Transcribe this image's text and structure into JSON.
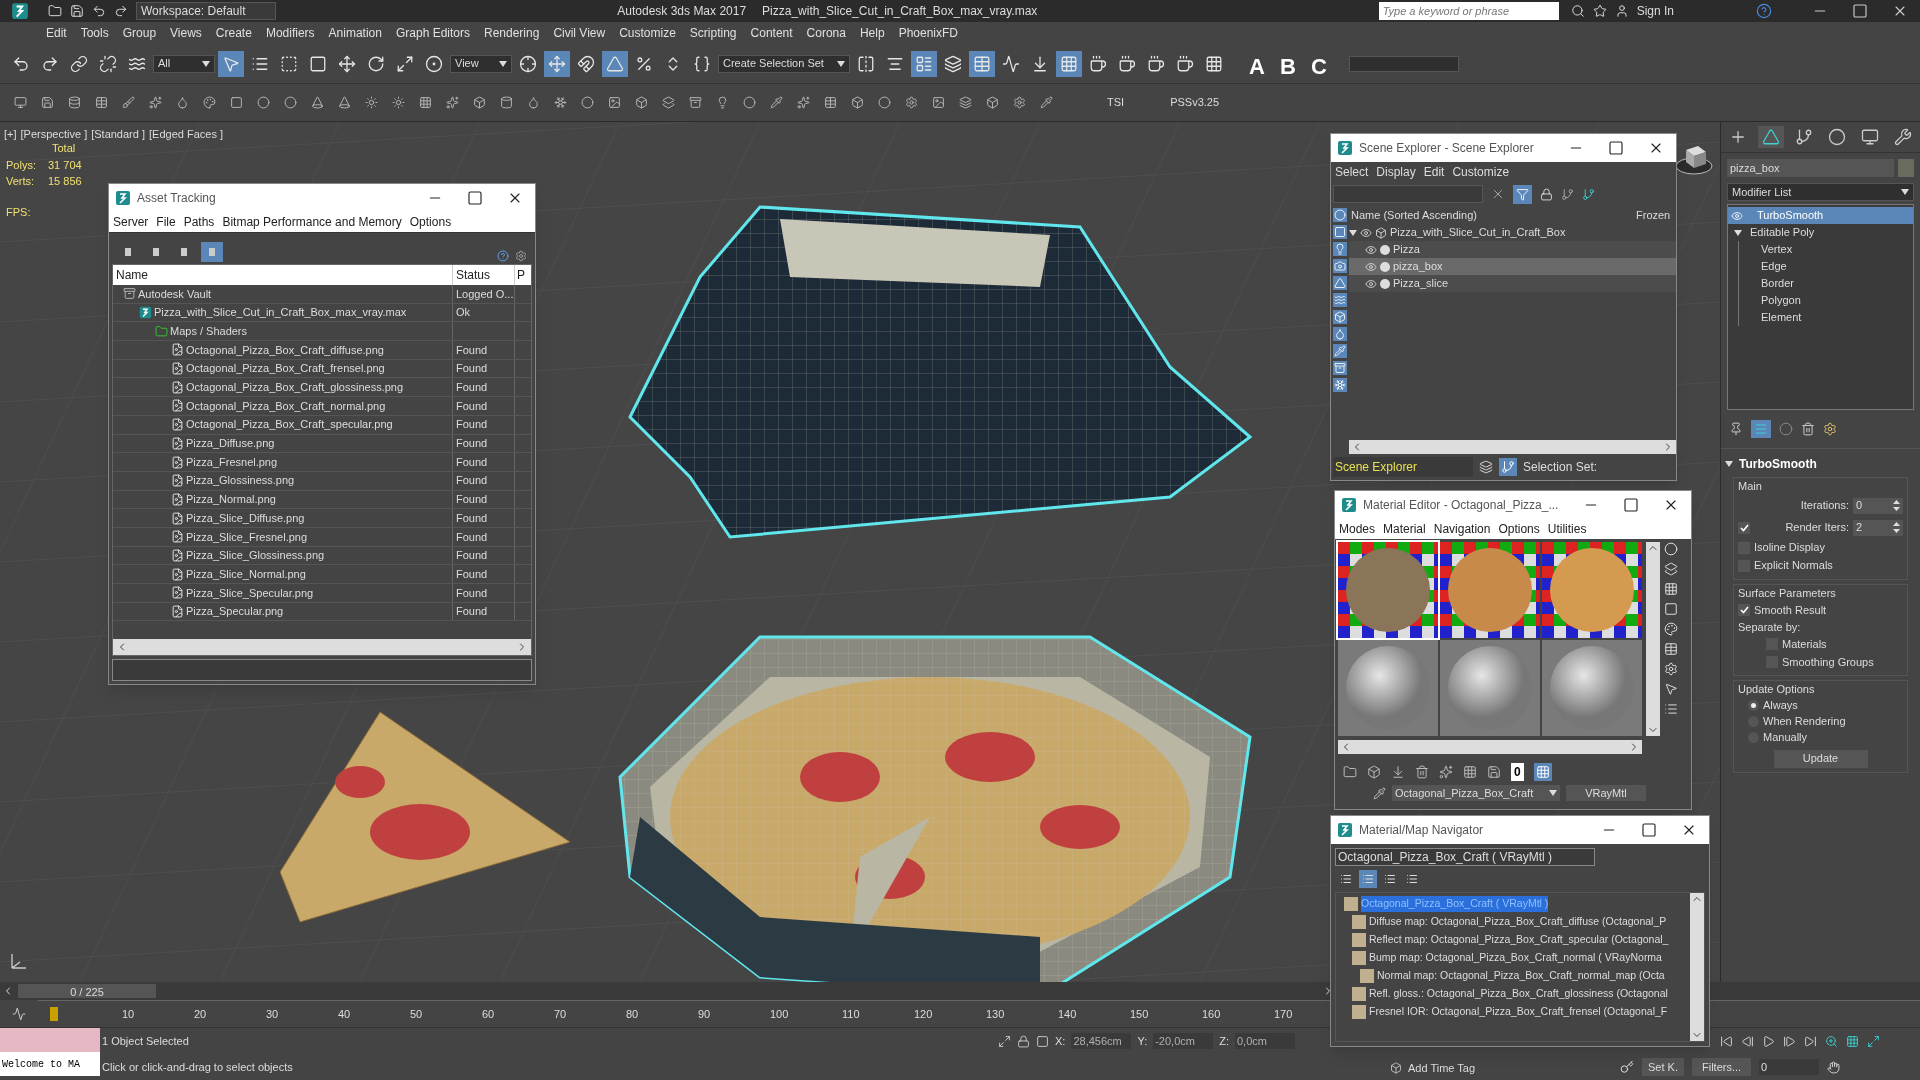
{
  "title_bar": {
    "workspace": "Workspace: Default",
    "app_title": "Autodesk 3ds Max 2017",
    "file_title": "Pizza_with_Slice_Cut_in_Craft_Box_max_vray.max",
    "search_placeholder": "Type a keyword or phrase",
    "sign_in": "Sign In"
  },
  "menu": [
    "Edit",
    "Tools",
    "Group",
    "Views",
    "Create",
    "Modifiers",
    "Animation",
    "Graph Editors",
    "Rendering",
    "Civil View",
    "Customize",
    "Scripting",
    "Content",
    "Corona",
    "Help",
    "PhoenixFD"
  ],
  "main_toolbar": {
    "selection_filter": "All",
    "reference_coordinate": "View",
    "selection_set": "Create Selection Set",
    "letter_tools": [
      "A",
      "B",
      "C"
    ]
  },
  "secondary_toolbar": {
    "labels": [
      "TSI",
      "PSSv3.25"
    ]
  },
  "viewport": {
    "labels": [
      "[+]",
      "[Perspective ]",
      "[Standard ]",
      "[Edged Faces ]"
    ],
    "stats_header": "Total",
    "stats": [
      {
        "label": "Polys:",
        "value": "31 704"
      },
      {
        "label": "Verts:",
        "value": "15 856"
      }
    ],
    "fps": "FPS:"
  },
  "asset_tracking": {
    "title": "Asset Tracking",
    "menu": [
      "Server",
      "File",
      "Paths",
      "Bitmap Performance and Memory",
      "Options"
    ],
    "view_buttons": [
      {
        "selected": false
      },
      {
        "selected": false
      },
      {
        "selected": false
      },
      {
        "selected": true
      }
    ],
    "columns": [
      "Name",
      "Status",
      "P"
    ],
    "tree": [
      {
        "kind": "vault",
        "name": "Autodesk Vault",
        "status": "Logged O...",
        "children": [
          {
            "kind": "max",
            "name": "Pizza_with_Slice_Cut_in_Craft_Box_max_vray.max",
            "status": "Ok",
            "children": [
              {
                "kind": "folder",
                "name": "Maps / Shaders",
                "children": [
                  {
                    "kind": "bitmap",
                    "name": "Octagonal_Pizza_Box_Craft_diffuse.png",
                    "status": "Found"
                  },
                  {
                    "kind": "bitmap",
                    "name": "Octagonal_Pizza_Box_Craft_frensel.png",
                    "status": "Found"
                  },
                  {
                    "kind": "bitmap",
                    "name": "Octagonal_Pizza_Box_Craft_glossiness.png",
                    "status": "Found"
                  },
                  {
                    "kind": "bitmap",
                    "name": "Octagonal_Pizza_Box_Craft_normal.png",
                    "status": "Found"
                  },
                  {
                    "kind": "bitmap",
                    "name": "Octagonal_Pizza_Box_Craft_specular.png",
                    "status": "Found"
                  },
                  {
                    "kind": "bitmap",
                    "name": "Pizza_Diffuse.png",
                    "status": "Found"
                  },
                  {
                    "kind": "bitmap",
                    "name": "Pizza_Fresnel.png",
                    "status": "Found"
                  },
                  {
                    "kind": "bitmap",
                    "name": "Pizza_Glossiness.png",
                    "status": "Found"
                  },
                  {
                    "kind": "bitmap",
                    "name": "Pizza_Normal.png",
                    "status": "Found"
                  },
                  {
                    "kind": "bitmap",
                    "name": "Pizza_Slice_Diffuse.png",
                    "status": "Found"
                  },
                  {
                    "kind": "bitmap",
                    "name": "Pizza_Slice_Fresnel.png",
                    "status": "Found"
                  },
                  {
                    "kind": "bitmap",
                    "name": "Pizza_Slice_Glossiness.png",
                    "status": "Found"
                  },
                  {
                    "kind": "bitmap",
                    "name": "Pizza_Slice_Normal.png",
                    "status": "Found"
                  },
                  {
                    "kind": "bitmap",
                    "name": "Pizza_Slice_Specular.png",
                    "status": "Found"
                  },
                  {
                    "kind": "bitmap",
                    "name": "Pizza_Specular.png",
                    "status": "Found"
                  }
                ]
              }
            ]
          }
        ]
      }
    ]
  },
  "scene_explorer": {
    "title": "Scene Explorer - Scene Explorer",
    "menu": [
      "Select",
      "Display",
      "Edit",
      "Customize"
    ],
    "columns": [
      "Name (Sorted Ascending)",
      "Frozen"
    ],
    "tree": [
      {
        "name": "Pizza_with_Slice_Cut_in_Craft_Box",
        "selected": false,
        "expanded": true,
        "children": [
          {
            "name": "Pizza",
            "selected": false
          },
          {
            "name": "pizza_box",
            "selected": true
          },
          {
            "name": "Pizza_slice",
            "selected": false
          }
        ]
      }
    ],
    "explorer_name": "Scene Explorer",
    "selection_set_label": "Selection Set:"
  },
  "material_editor": {
    "title": "Material Editor - Octagonal_Pizza_...",
    "menu": [
      "Modes",
      "Material",
      "Navigation",
      "Options",
      "Utilities"
    ],
    "slots": [
      {
        "kind": "textured",
        "selected": true
      },
      {
        "kind": "textured",
        "selected": false
      },
      {
        "kind": "textured",
        "selected": false
      },
      {
        "kind": "blank",
        "selected": false
      },
      {
        "kind": "blank",
        "selected": false
      },
      {
        "kind": "blank",
        "selected": false
      }
    ],
    "sample_count": "0",
    "material_name": "Octagonal_Pizza_Box_Craft",
    "material_type": "VRayMtl"
  },
  "navigator": {
    "title": "Material/Map Navigator",
    "field": "Octagonal_Pizza_Box_Craft  ( VRayMtl )",
    "view_buttons": [
      {
        "selected": false
      },
      {
        "selected": true
      },
      {
        "selected": false
      },
      {
        "selected": false
      }
    ],
    "tree": [
      {
        "name": "Octagonal_Pizza_Box_Craft  ( VRayMtl )",
        "selected": true,
        "children": [
          {
            "name": "Diffuse map: Octagonal_Pizza_Box_Craft_diffuse (Octagonal_P",
            "selected": false
          },
          {
            "name": "Reflect map: Octagonal_Pizza_Box_Craft_specular (Octagonal_",
            "selected": false
          },
          {
            "name": "Bump map: Octagonal_Pizza_Box_Craft_normal  ( VRayNorma",
            "selected": false,
            "children": [
              {
                "name": "Normal map: Octagonal_Pizza_Box_Craft_normal_map (Octa",
                "selected": false
              }
            ]
          },
          {
            "name": "Refl. gloss.: Octagonal_Pizza_Box_Craft_glossiness (Octagonal",
            "selected": false
          },
          {
            "name": "Fresnel IOR: Octagonal_Pizza_Box_Craft_frensel (Octagonal_F",
            "selected": false
          }
        ]
      }
    ]
  },
  "command_panel": {
    "object_name": "pizza_box",
    "modifier_list": "Modifier List",
    "stack": [
      {
        "name": "TurboSmooth",
        "selected": true
      },
      {
        "name": "Editable Poly",
        "selected": false,
        "children": [
          {
            "name": "Vertex"
          },
          {
            "name": "Edge"
          },
          {
            "name": "Border"
          },
          {
            "name": "Polygon"
          },
          {
            "name": "Element"
          }
        ]
      }
    ],
    "rollout_title": "TurboSmooth",
    "groups": [
      {
        "title": "Main",
        "controls": [
          {
            "kind": "spinner",
            "label": "Iterations:",
            "value": "0"
          },
          {
            "kind": "spinner",
            "label": "Render Iters:",
            "value": "2",
            "checked": true
          },
          {
            "kind": "checkbox",
            "label": "Isoline Display",
            "checked": false
          },
          {
            "kind": "checkbox",
            "label": "Explicit Normals",
            "checked": false
          }
        ]
      },
      {
        "title": "Surface Parameters",
        "controls": [
          {
            "kind": "checkbox",
            "label": "Smooth Result",
            "checked": true
          },
          {
            "kind": "text",
            "label": "Separate by:"
          },
          {
            "kind": "subcheckbox",
            "label": "Materials",
            "checked": false
          },
          {
            "kind": "subcheckbox",
            "label": "Smoothing Groups",
            "checked": false
          }
        ]
      },
      {
        "title": "Update Options",
        "controls": [
          {
            "kind": "radio",
            "label": "Always",
            "selected": true
          },
          {
            "kind": "radio",
            "label": "When Rendering",
            "selected": false
          },
          {
            "kind": "radio",
            "label": "Manually",
            "selected": false
          },
          {
            "kind": "button",
            "label": "Update"
          }
        ]
      }
    ]
  },
  "timeline": {
    "frame": "0 / 225",
    "ticks": [
      "10",
      "20",
      "30",
      "40",
      "50",
      "60",
      "70",
      "80",
      "90",
      "100",
      "110",
      "120",
      "130",
      "140",
      "150",
      "160",
      "170"
    ]
  },
  "status_bar": {
    "listener": "Welcome to MA",
    "selection": "1 Object Selected",
    "prompt": "Click or click-and-drag to select objects",
    "coords": [
      {
        "label": "X:",
        "value": "28,456cm"
      },
      {
        "label": "Y:",
        "value": "-20,0cm"
      },
      {
        "label": "Z:",
        "value": "0,0cm"
      }
    ],
    "add_time_tag": "Add Time Tag",
    "set_key": "Set K.",
    "filters": "Filters...",
    "current_frame": "0"
  }
}
